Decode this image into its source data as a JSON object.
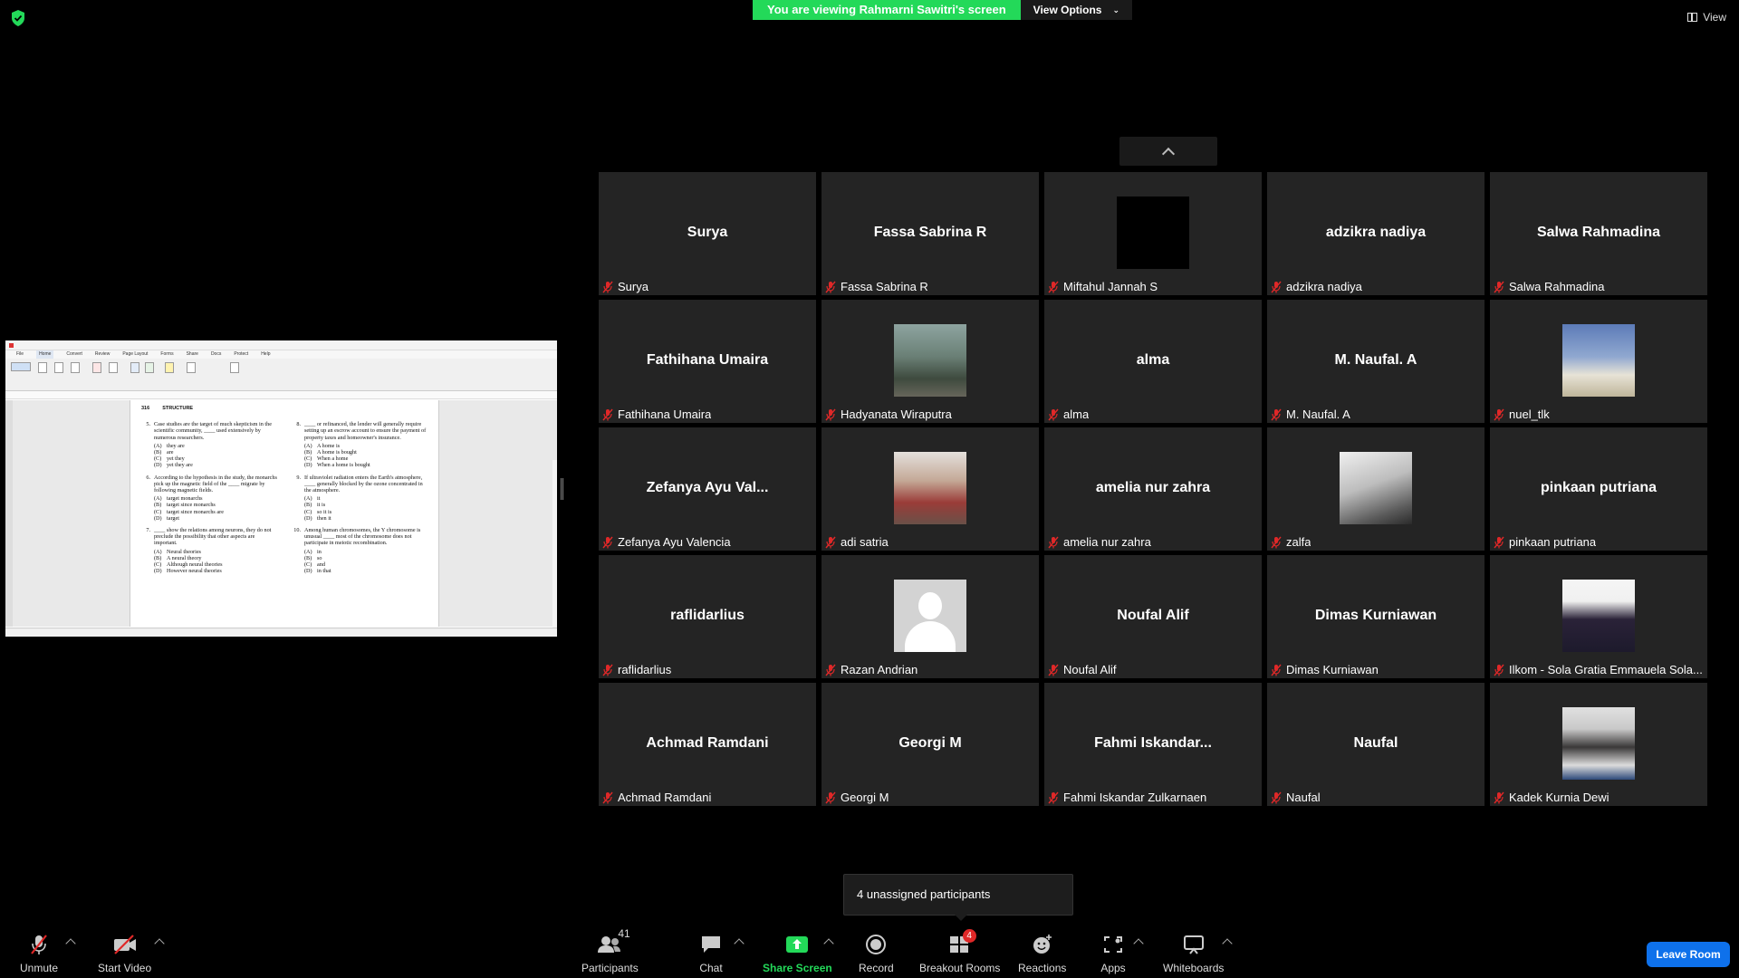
{
  "banner": {
    "text": "You are viewing Rahmarni Sawitri's screen",
    "view_options": "View Options"
  },
  "top_right": {
    "view_label": "View"
  },
  "shared_screen": {
    "menu": [
      "File",
      "Home",
      "Convert",
      "Review",
      "Page Layout",
      "Forms",
      "Share",
      "Docs",
      "Protect",
      "Help"
    ],
    "page_header": {
      "page": "316",
      "section": "STRUCTURE"
    },
    "col_left": [
      {
        "num": "5.",
        "text": "Case studies are the target of much skepticism in the scientific community, ____ used extensively by numerous researchers.",
        "options": [
          [
            "(A)",
            "they are"
          ],
          [
            "(B)",
            "are"
          ],
          [
            "(C)",
            "yet they"
          ],
          [
            "(D)",
            "yet they are"
          ]
        ]
      },
      {
        "num": "6.",
        "text": "According to the hypothesis in the study, the monarchs pick up the magnetic field of the ____ migrate by following magnetic fields.",
        "options": [
          [
            "(A)",
            "target monarchs"
          ],
          [
            "(B)",
            "target since monarchs"
          ],
          [
            "(C)",
            "target since monarchs are"
          ],
          [
            "(D)",
            "target"
          ]
        ]
      },
      {
        "num": "7.",
        "text": "____ show the relations among neurons, they do not preclude the possibility that other aspects are important.",
        "options": [
          [
            "(A)",
            "Neural theories"
          ],
          [
            "(B)",
            "A neural theory"
          ],
          [
            "(C)",
            "Although neural theories"
          ],
          [
            "(D)",
            "However neural theories"
          ]
        ]
      }
    ],
    "col_right": [
      {
        "num": "8.",
        "text": "____ or refinanced, the lender will generally require setting up an escrow account to ensure the payment of property taxes and homeowner's insurance.",
        "options": [
          [
            "(A)",
            "A home is"
          ],
          [
            "(B)",
            "A home is bought"
          ],
          [
            "(C)",
            "When a home"
          ],
          [
            "(D)",
            "When a home is bought"
          ]
        ]
      },
      {
        "num": "9.",
        "text": "If ultraviolet radiation enters the Earth's atmosphere, ____ generally blocked by the ozone concentrated in the atmosphere.",
        "options": [
          [
            "(A)",
            "it"
          ],
          [
            "(B)",
            "it is"
          ],
          [
            "(C)",
            "so it is"
          ],
          [
            "(D)",
            "then it"
          ]
        ]
      },
      {
        "num": "10.",
        "text": "Among human chromosomes, the Y chromosome is unusual ____ most of the chromosome does not participate in meiotic recombination.",
        "options": [
          [
            "(A)",
            "in"
          ],
          [
            "(B)",
            "so"
          ],
          [
            "(C)",
            "and"
          ],
          [
            "(D)",
            "in that"
          ]
        ]
      }
    ]
  },
  "tiles": [
    {
      "display": "Surya",
      "name": "Surya",
      "photo": null
    },
    {
      "display": "Fassa Sabrina R",
      "name": "Fassa Sabrina R",
      "photo": null
    },
    {
      "display": "",
      "name": "Miftahul Jannah S",
      "photo": "ph-black"
    },
    {
      "display": "adzikra nadiya",
      "name": "adzikra nadiya",
      "photo": null
    },
    {
      "display": "Salwa Rahmadina",
      "name": "Salwa Rahmadina",
      "photo": null
    },
    {
      "display": "Fathihana Umaira",
      "name": "Fathihana Umaira",
      "photo": null
    },
    {
      "display": "",
      "name": "Hadyanata Wiraputra",
      "photo": "ph-street"
    },
    {
      "display": "alma",
      "name": "alma",
      "photo": null
    },
    {
      "display": "M. Naufal. A",
      "name": "M. Naufal. A",
      "photo": null
    },
    {
      "display": "",
      "name": "nuel_tlk",
      "photo": "ph-beach"
    },
    {
      "display": "Zefanya Ayu Val...",
      "name": "Zefanya Ayu Valencia",
      "photo": null
    },
    {
      "display": "",
      "name": "adi satria",
      "photo": "ph-red"
    },
    {
      "display": "amelia nur zahra",
      "name": "amelia nur zahra",
      "photo": null
    },
    {
      "display": "",
      "name": "zalfa",
      "photo": "ph-gray"
    },
    {
      "display": "pinkaan putriana",
      "name": "pinkaan putriana",
      "photo": null
    },
    {
      "display": "raflidarlius",
      "name": "raflidarlius",
      "photo": null
    },
    {
      "display": "",
      "name": "Razan Andrian",
      "photo": "ph-avatar"
    },
    {
      "display": "Noufal Alif",
      "name": "Noufal Alif",
      "photo": null
    },
    {
      "display": "Dimas Kurniawan",
      "name": "Dimas Kurniawan",
      "photo": null
    },
    {
      "display": "",
      "name": "Ilkom - Sola Gratia Emmauela Sola...",
      "photo": "ph-portrait1"
    },
    {
      "display": "Achmad Ramdani",
      "name": "Achmad Ramdani",
      "photo": null
    },
    {
      "display": "Georgi M",
      "name": "Georgi M",
      "photo": null
    },
    {
      "display": "Fahmi  Iskandar...",
      "name": "Fahmi Iskandar Zulkarnaen",
      "photo": null
    },
    {
      "display": "Naufal",
      "name": "Naufal",
      "photo": null
    },
    {
      "display": "",
      "name": "Kadek Kurnia Dewi",
      "photo": "ph-portrait2"
    }
  ],
  "toast": {
    "text": "4 unassigned participants"
  },
  "toolbar": {
    "unmute": "Unmute",
    "start_video": "Start Video",
    "participants": "Participants",
    "participants_count": "41",
    "chat": "Chat",
    "share_screen": "Share Screen",
    "record": "Record",
    "breakout_rooms": "Breakout Rooms",
    "breakout_badge": "4",
    "reactions": "Reactions",
    "apps": "Apps",
    "whiteboards": "Whiteboards",
    "leave": "Leave Room"
  },
  "colors": {
    "green": "#23d959",
    "blue": "#0e71eb",
    "red": "#e02828",
    "tile": "#242424"
  }
}
